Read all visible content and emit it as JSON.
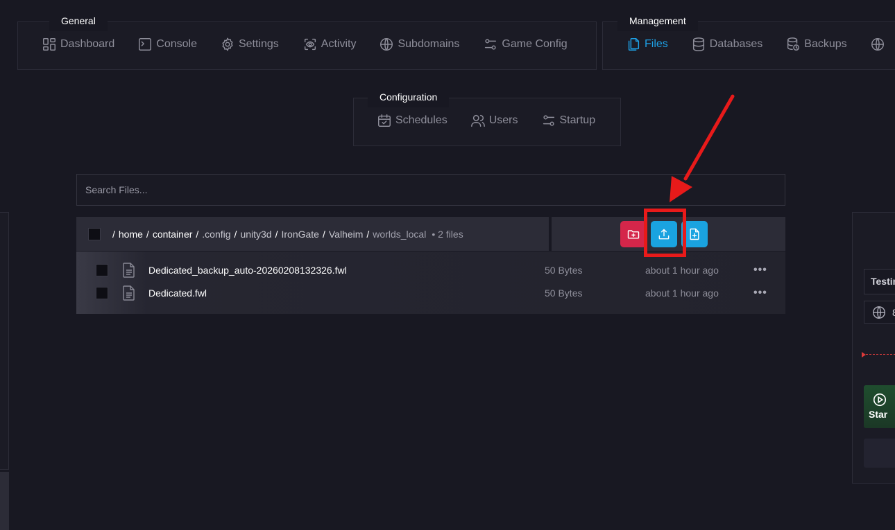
{
  "nav": {
    "general": {
      "title": "General",
      "items": [
        {
          "label": "Dashboard",
          "icon": "dashboard-icon"
        },
        {
          "label": "Console",
          "icon": "terminal-icon"
        },
        {
          "label": "Settings",
          "icon": "gear-icon"
        },
        {
          "label": "Activity",
          "icon": "eye-scan-icon"
        },
        {
          "label": "Subdomains",
          "icon": "globe-icon"
        },
        {
          "label": "Game Config",
          "icon": "sliders-icon"
        }
      ]
    },
    "management": {
      "title": "Management",
      "items": [
        {
          "label": "Files",
          "icon": "files-icon",
          "active": true
        },
        {
          "label": "Databases",
          "icon": "database-icon"
        },
        {
          "label": "Backups",
          "icon": "backup-database-icon"
        },
        {
          "label": "",
          "icon": "globe-icon"
        }
      ]
    },
    "configuration": {
      "title": "Configuration",
      "items": [
        {
          "label": "Schedules",
          "icon": "calendar-check-icon"
        },
        {
          "label": "Users",
          "icon": "users-icon"
        },
        {
          "label": "Startup",
          "icon": "sliders-icon"
        }
      ]
    }
  },
  "search": {
    "placeholder": "Search Files..."
  },
  "path": {
    "root_sep": "/",
    "crumbs": [
      "home",
      "container",
      ".config",
      "unity3d",
      "IronGate",
      "Valheim"
    ],
    "current": "worlds_local",
    "count": "• 2 files"
  },
  "actions": {
    "new_folder": "new-folder-icon",
    "upload": "upload-icon",
    "new_file": "new-file-icon"
  },
  "files": [
    {
      "name": "Dedicated_backup_auto-20260208132326.fwl",
      "size": "50 Bytes",
      "modified": "about 1 hour ago"
    },
    {
      "name": "Dedicated.fwl",
      "size": "50 Bytes",
      "modified": "about 1 hour ago"
    }
  ],
  "right_panel": {
    "server_name": "Testin",
    "address": "8",
    "start_label": "Star"
  },
  "colors": {
    "background": "#181822",
    "accent": "#1aa3e0",
    "danger": "#d5264a",
    "annotation": "#e81a1a"
  }
}
